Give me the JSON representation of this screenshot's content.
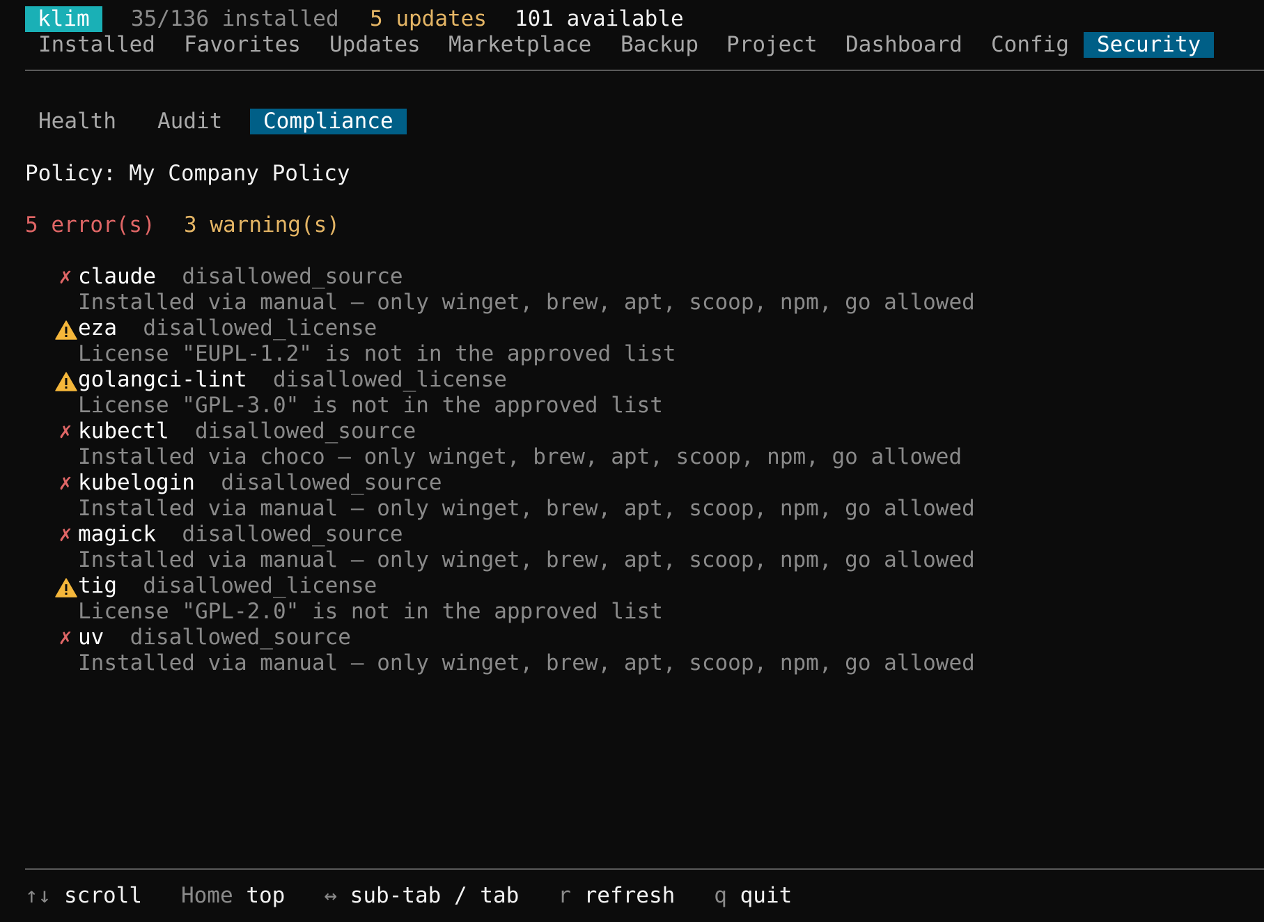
{
  "header": {
    "app_name": "klim",
    "installed": "35/136 installed",
    "updates": "5 updates",
    "available": "101 available"
  },
  "tabs": [
    {
      "label": "Installed",
      "active": false
    },
    {
      "label": "Favorites",
      "active": false
    },
    {
      "label": "Updates",
      "active": false
    },
    {
      "label": "Marketplace",
      "active": false
    },
    {
      "label": "Backup",
      "active": false
    },
    {
      "label": "Project",
      "active": false
    },
    {
      "label": "Dashboard",
      "active": false
    },
    {
      "label": "Config",
      "active": false
    },
    {
      "label": "Security",
      "active": true
    }
  ],
  "subtabs": [
    {
      "label": "Health",
      "active": false
    },
    {
      "label": "Audit",
      "active": false
    },
    {
      "label": "Compliance",
      "active": true
    }
  ],
  "compliance": {
    "policy": "Policy: My Company Policy",
    "errors": "5 error(s)",
    "warnings": "3 warning(s)",
    "issues": [
      {
        "severity": "error",
        "icon": "x-icon",
        "symbol": "✗",
        "name": "claude",
        "rule": "disallowed_source",
        "detail": "Installed via manual – only winget, brew, apt, scoop, npm, go allowed"
      },
      {
        "severity": "warning",
        "icon": "warning-icon",
        "name": "eza",
        "rule": "disallowed_license",
        "detail": "License \"EUPL-1.2\" is not in the approved list"
      },
      {
        "severity": "warning",
        "icon": "warning-icon",
        "name": "golangci-lint",
        "rule": "disallowed_license",
        "detail": "License \"GPL-3.0\" is not in the approved list"
      },
      {
        "severity": "error",
        "icon": "x-icon",
        "symbol": "✗",
        "name": "kubectl",
        "rule": "disallowed_source",
        "detail": "Installed via choco – only winget, brew, apt, scoop, npm, go allowed"
      },
      {
        "severity": "error",
        "icon": "x-icon",
        "symbol": "✗",
        "name": "kubelogin",
        "rule": "disallowed_source",
        "detail": "Installed via manual – only winget, brew, apt, scoop, npm, go allowed"
      },
      {
        "severity": "error",
        "icon": "x-icon",
        "symbol": "✗",
        "name": "magick",
        "rule": "disallowed_source",
        "detail": "Installed via manual – only winget, brew, apt, scoop, npm, go allowed"
      },
      {
        "severity": "warning",
        "icon": "warning-icon",
        "name": "tig",
        "rule": "disallowed_license",
        "detail": "License \"GPL-2.0\" is not in the approved list"
      },
      {
        "severity": "error",
        "icon": "x-icon",
        "symbol": "✗",
        "name": "uv",
        "rule": "disallowed_source",
        "detail": "Installed via manual – only winget, brew, apt, scoop, npm, go allowed"
      }
    ]
  },
  "footer": [
    {
      "key": "↑↓",
      "action": "scroll"
    },
    {
      "key": "Home",
      "action": "top"
    },
    {
      "key": "↔",
      "action": "sub-tab / tab"
    },
    {
      "key": "r",
      "action": "refresh"
    },
    {
      "key": "q",
      "action": "quit"
    }
  ],
  "colors": {
    "background": "#0c0c0c",
    "accent": "#005f87",
    "brand": "#1ab0b6",
    "error": "#e06666",
    "warning": "#e4b565",
    "warning_icon": "#f5b73b",
    "muted": "#8a8a8a"
  }
}
